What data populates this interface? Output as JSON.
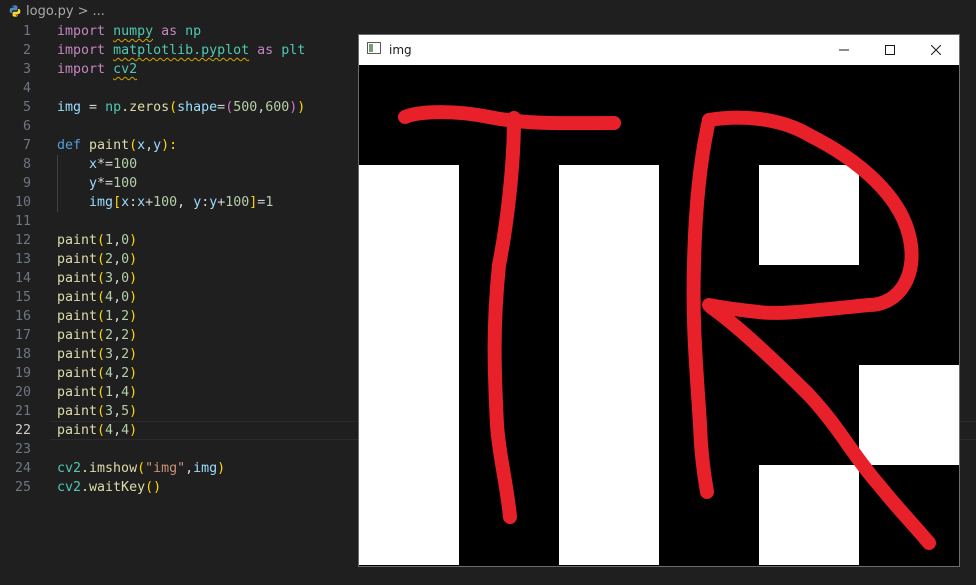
{
  "breadcrumb": {
    "file": "logo.py",
    "separator": ">",
    "more": "..."
  },
  "editor": {
    "active_line": 22,
    "lines": [
      {
        "n": "1"
      },
      {
        "n": "2"
      },
      {
        "n": "3"
      },
      {
        "n": "4"
      },
      {
        "n": "5"
      },
      {
        "n": "6"
      },
      {
        "n": "7"
      },
      {
        "n": "8"
      },
      {
        "n": "9"
      },
      {
        "n": "10"
      },
      {
        "n": "11"
      },
      {
        "n": "12"
      },
      {
        "n": "13"
      },
      {
        "n": "14"
      },
      {
        "n": "15"
      },
      {
        "n": "16"
      },
      {
        "n": "17"
      },
      {
        "n": "18"
      },
      {
        "n": "19"
      },
      {
        "n": "20"
      },
      {
        "n": "21"
      },
      {
        "n": "22"
      },
      {
        "n": "23"
      },
      {
        "n": "24"
      },
      {
        "n": "25"
      }
    ],
    "code": {
      "l1": [
        "import",
        "numpy",
        "as",
        "np"
      ],
      "l2": [
        "import",
        "matplotlib.pyplot",
        "as",
        "plt"
      ],
      "l3": [
        "import",
        "cv2"
      ],
      "l5": [
        "img",
        "=",
        "np",
        ".zeros",
        "(",
        "shape",
        "=",
        "(",
        "500",
        ",",
        "600",
        ")",
        ")"
      ],
      "l7": [
        "def",
        "paint",
        "(",
        "x",
        ",",
        "y",
        "):"
      ],
      "l8": [
        "x",
        "*=",
        "100"
      ],
      "l9": [
        "y",
        "*=",
        "100"
      ],
      "l10": [
        "img",
        "[",
        "x",
        ":",
        "x",
        "+",
        "100",
        ", ",
        "y",
        ":",
        "y",
        "+",
        "100",
        "]",
        "=",
        "1"
      ],
      "l12": "paint(1,0)",
      "l13": "paint(2,0)",
      "l14": "paint(3,0)",
      "l15": "paint(4,0)",
      "l16": "paint(1,2)",
      "l17": "paint(2,2)",
      "l18": "paint(3,2)",
      "l19": "paint(4,2)",
      "l20": "paint(1,4)",
      "l21": "paint(3,5)",
      "l22": "paint(4,4)",
      "l24": [
        "cv2",
        ".imshow",
        "(",
        "\"img\"",
        ",",
        "img",
        ")"
      ],
      "l25": [
        "cv2",
        ".waitKey",
        "(",
        ")"
      ]
    }
  },
  "window": {
    "title": "img",
    "icons": {
      "app": "image-window-icon",
      "minimize": "minimize-icon",
      "maximize": "maximize-icon",
      "close": "close-icon"
    },
    "image": {
      "background": "#000000",
      "fill_color": "#ffffff",
      "stroke_color": "#e8202a",
      "painted_cells": [
        [
          1,
          0
        ],
        [
          2,
          0
        ],
        [
          3,
          0
        ],
        [
          4,
          0
        ],
        [
          1,
          2
        ],
        [
          2,
          2
        ],
        [
          3,
          2
        ],
        [
          4,
          2
        ],
        [
          1,
          4
        ],
        [
          3,
          5
        ],
        [
          4,
          4
        ]
      ]
    }
  }
}
